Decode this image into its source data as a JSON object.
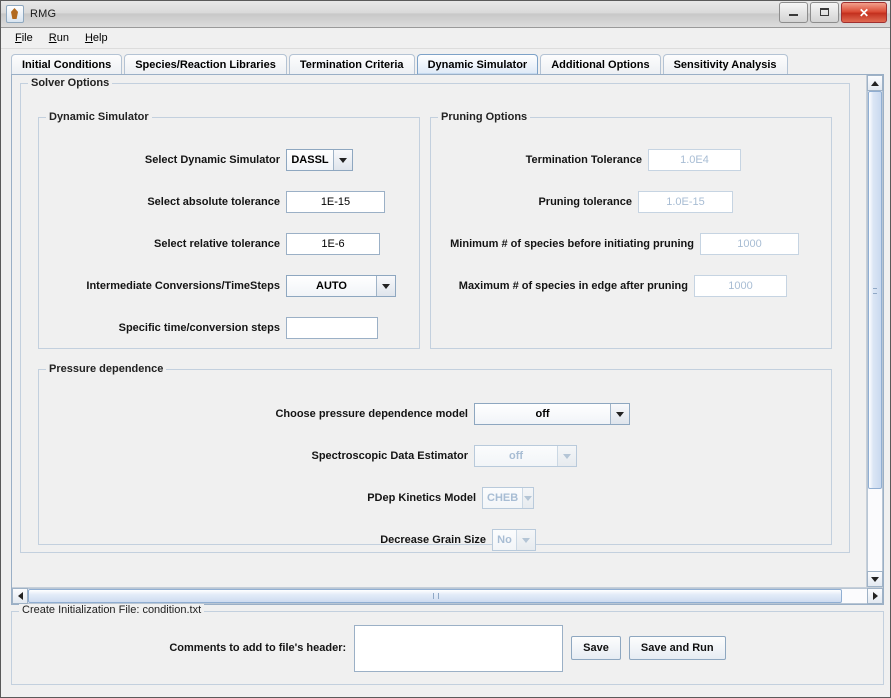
{
  "window": {
    "title": "RMG",
    "icon": "app-icon",
    "buttons": {
      "minimize": "–",
      "maximize": "□",
      "close": "✕"
    }
  },
  "menubar": {
    "items": [
      {
        "label": "File",
        "mnemonic": "F"
      },
      {
        "label": "Run",
        "mnemonic": "R"
      },
      {
        "label": "Help",
        "mnemonic": "H"
      }
    ]
  },
  "tabs": [
    {
      "label": "Initial Conditions",
      "active": false
    },
    {
      "label": "Species/Reaction Libraries",
      "active": false
    },
    {
      "label": "Termination Criteria",
      "active": false
    },
    {
      "label": "Dynamic Simulator",
      "active": true
    },
    {
      "label": "Additional Options",
      "active": false
    },
    {
      "label": "Sensitivity Analysis",
      "active": false
    }
  ],
  "solver_options": {
    "legend": "Solver Options",
    "dynamic_simulator": {
      "legend": "Dynamic Simulator",
      "fields": {
        "select_dynamic_simulator": {
          "label": "Select Dynamic Simulator",
          "value": "DASSL",
          "type": "combo",
          "enabled": true
        },
        "absolute_tolerance": {
          "label": "Select absolute tolerance",
          "value": "1E-15",
          "type": "text",
          "enabled": true
        },
        "relative_tolerance": {
          "label": "Select relative tolerance",
          "value": "1E-6",
          "type": "text",
          "enabled": true
        },
        "intermediate_conversions": {
          "label": "Intermediate Conversions/TimeSteps",
          "value": "AUTO",
          "type": "combo",
          "enabled": true
        },
        "specific_steps": {
          "label": "Specific time/conversion steps",
          "value": "",
          "type": "text",
          "enabled": true
        }
      }
    },
    "pruning_options": {
      "legend": "Pruning Options",
      "fields": {
        "termination_tolerance": {
          "label": "Termination Tolerance",
          "value": "1.0E4",
          "type": "text",
          "enabled": false
        },
        "pruning_tolerance": {
          "label": "Pruning tolerance",
          "value": "1.0E-15",
          "type": "text",
          "enabled": false
        },
        "min_species_before_pruning": {
          "label": "Minimum # of species before initiating pruning",
          "value": "1000",
          "type": "text",
          "enabled": false
        },
        "max_species_edge_after_pruning": {
          "label": "Maximum # of species in edge after pruning",
          "value": "1000",
          "type": "text",
          "enabled": false
        }
      }
    },
    "pressure_dependence": {
      "legend": "Pressure dependence",
      "fields": {
        "model": {
          "label": "Choose pressure dependence model",
          "value": "off",
          "type": "combo",
          "enabled": true
        },
        "spectroscopic_estimator": {
          "label": "Spectroscopic Data Estimator",
          "value": "off",
          "type": "combo",
          "enabled": false
        },
        "pdep_kinetics_model": {
          "label": "PDep Kinetics Model",
          "value": "CHEB",
          "type": "combo",
          "enabled": false
        },
        "decrease_grain_size": {
          "label": "Decrease Grain Size",
          "value": "No",
          "type": "combo",
          "enabled": false
        }
      }
    }
  },
  "init_file_panel": {
    "legend": "Create Initialization File: condition.txt",
    "comments_label": "Comments to add to file's header:",
    "comments_value": "",
    "save_label": "Save",
    "save_and_run_label": "Save and Run"
  },
  "scrollbars": {
    "vertical": {
      "up": "scroll-up",
      "down": "scroll-down",
      "thumb_percent": 83
    },
    "horizontal": {
      "left": "scroll-left",
      "right": "scroll-right",
      "thumb_percent": 97
    }
  },
  "colors": {
    "panel_bg": "#f0f0f0",
    "accent_border": "#7da2c8",
    "disabled_text": "#a8bdd4",
    "close_button": "#d8452f"
  }
}
